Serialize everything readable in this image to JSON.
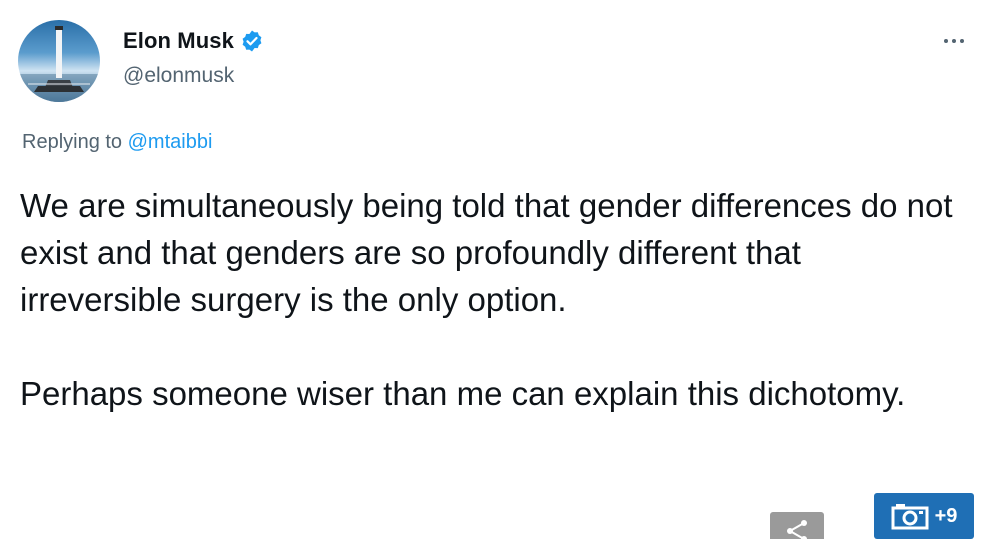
{
  "author": {
    "display_name": "Elon Musk",
    "handle": "@elonmusk",
    "verified_icon": "verified-badge-icon",
    "avatar_icon": "rocket-launch-avatar"
  },
  "reply": {
    "prefix": "Replying to ",
    "mention": "@mtaibbi"
  },
  "tweet": {
    "paragraphs": [
      "We are simultaneously being told that gender differences do not exist and that genders are so profoundly different that irreversible surgery is the only option.",
      "Perhaps someone wiser than me can explain this dichotomy."
    ]
  },
  "overlay": {
    "gallery_count": "+9",
    "gallery_icon": "camera-icon",
    "share_icon": "share-icon"
  },
  "colors": {
    "text": "#0f1419",
    "secondary": "#536471",
    "accent": "#1d9bf0",
    "verified": "#1d9bf0",
    "badge_bg": "#1f6fb5"
  }
}
